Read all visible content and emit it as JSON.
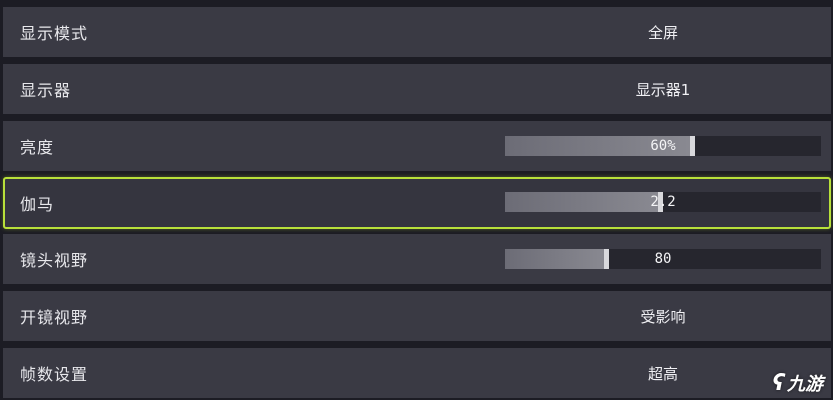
{
  "settings": [
    {
      "label": "显示模式",
      "type": "select",
      "value": "全屏"
    },
    {
      "label": "显示器",
      "type": "select",
      "value": "显示器1"
    },
    {
      "label": "亮度",
      "type": "slider",
      "value": "60%",
      "level": 0.6
    },
    {
      "label": "伽马",
      "type": "slider",
      "value": "2.2",
      "level": 0.5
    },
    {
      "label": "镜头视野",
      "type": "slider",
      "value": "80",
      "level": 0.33
    },
    {
      "label": "开镜视野",
      "type": "select",
      "value": "受影响"
    },
    {
      "label": "帧数设置",
      "type": "select",
      "value": "超高"
    }
  ],
  "watermark": {
    "text": "九游",
    "logo_icon": "jiuyou-logo-icon"
  },
  "colors": {
    "row_bg": "#3a3a44",
    "highlight_border": "#b8e03a",
    "slider_track": "#26262e",
    "slider_fill": "#7a7a84"
  }
}
